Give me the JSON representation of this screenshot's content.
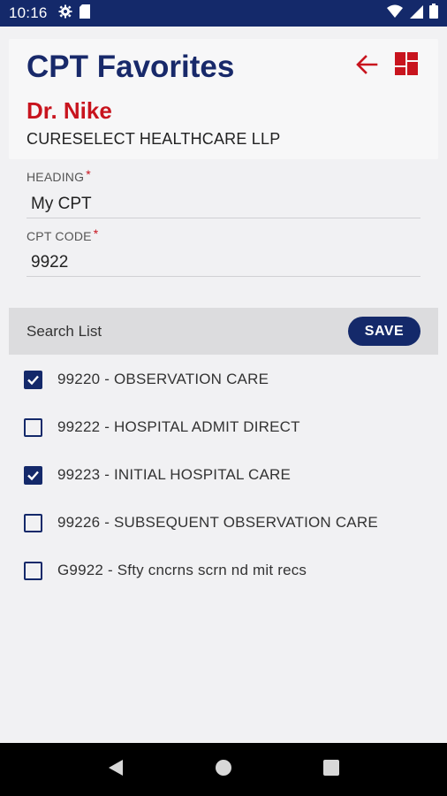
{
  "status_bar": {
    "time": "10:16",
    "icons": [
      "gear-icon",
      "sim-card-icon",
      "wifi-icon",
      "signal-icon",
      "battery-icon"
    ]
  },
  "header": {
    "title": "CPT Favorites",
    "doctor_name": "Dr. Nike",
    "organization": "CURESELECT HEALTHCARE LLP",
    "actions": [
      "back-arrow-icon",
      "dashboard-grid-icon"
    ]
  },
  "form": {
    "heading": {
      "label": "HEADING",
      "required": "*",
      "value": "My CPT"
    },
    "cpt_code": {
      "label": "CPT CODE",
      "required": "*",
      "value": "9922"
    }
  },
  "search": {
    "placeholder": "Search List",
    "save_label": "SAVE"
  },
  "cpt_items": [
    {
      "label": "99220 - OBSERVATION CARE",
      "checked": true
    },
    {
      "label": "99222 - HOSPITAL ADMIT DIRECT",
      "checked": false
    },
    {
      "label": "99223 - INITIAL HOSPITAL CARE",
      "checked": true
    },
    {
      "label": "99226 - SUBSEQUENT OBSERVATION CARE",
      "checked": false
    },
    {
      "label": "G9922 - Sfty cncrns scrn nd mit recs",
      "checked": false
    }
  ],
  "colors": {
    "primary": "#14296a",
    "accent": "#c8141e",
    "background": "#f1f1f3"
  },
  "nav": [
    "back-triangle-icon",
    "home-circle-icon",
    "recents-square-icon"
  ]
}
